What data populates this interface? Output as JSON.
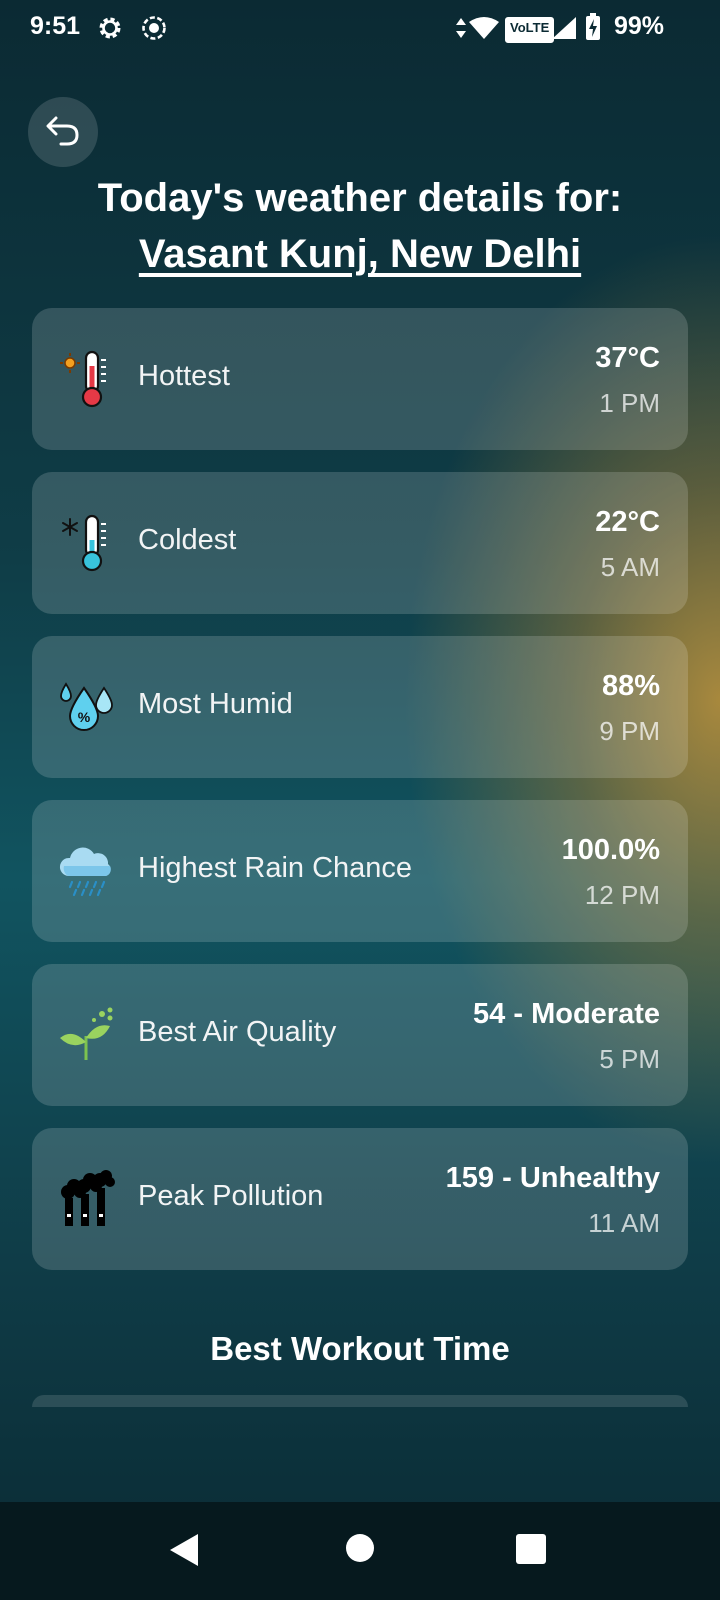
{
  "status_bar": {
    "time": "9:51",
    "volte": "VoLTE",
    "battery": "99%"
  },
  "header": {
    "title_line1": "Today's weather details for:",
    "location": "Vasant Kunj, New Delhi"
  },
  "cards": [
    {
      "icon": "hot-thermometer-icon",
      "label": "Hottest",
      "value": "37°C",
      "time": "1 PM"
    },
    {
      "icon": "cold-thermometer-icon",
      "label": "Coldest",
      "value": "22°C",
      "time": "5 AM"
    },
    {
      "icon": "humidity-drops-icon",
      "label": "Most Humid",
      "value": "88%",
      "time": "9 PM"
    },
    {
      "icon": "rain-cloud-icon",
      "label": "Highest Rain Chance",
      "value": "100.0%",
      "time": "12 PM"
    },
    {
      "icon": "plant-sprout-icon",
      "label": "Best Air Quality",
      "value": "54 - Moderate",
      "time": "5 PM"
    },
    {
      "icon": "factory-smoke-icon",
      "label": "Peak Pollution",
      "value": "159 - Unhealthy",
      "time": "11 AM"
    }
  ],
  "workout": {
    "title": "Best Workout Time"
  },
  "colors": {
    "accent_gold": "#b08c3c",
    "background_teal": "#0f3d47"
  }
}
